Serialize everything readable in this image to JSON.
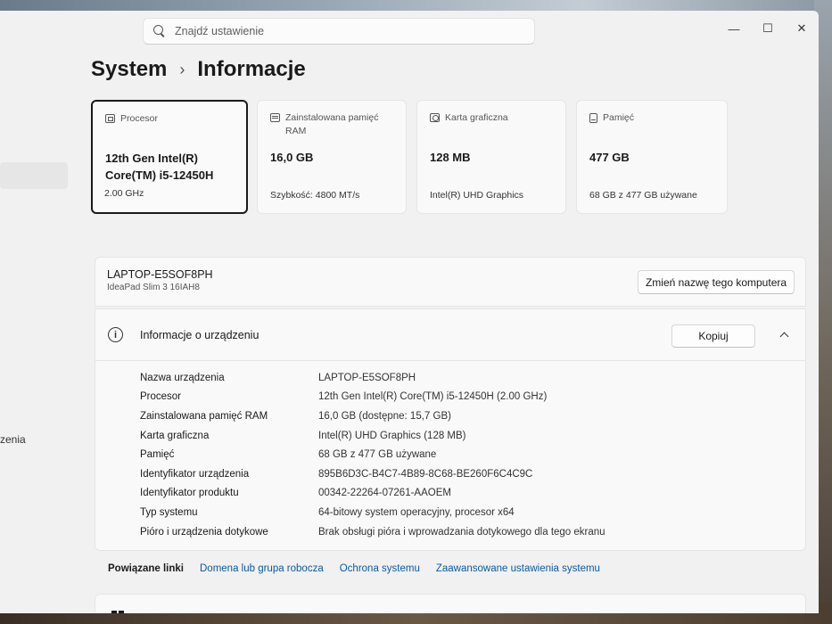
{
  "search": {
    "placeholder": "Znajdź ustawienie"
  },
  "window_controls": {
    "minimize": "—",
    "maximize": "☐",
    "close": "✕"
  },
  "breadcrumb": {
    "root": "System",
    "separator": "›",
    "current": "Informacje"
  },
  "sidebar": {
    "fragment_text": "zenia"
  },
  "cards": [
    {
      "icon": "processor-icon",
      "title": "Procesor",
      "value_line1": "12th Gen Intel(R)",
      "value_line2": "Core(TM) i5-12450H",
      "sub": "2.00 GHz"
    },
    {
      "icon": "memory-icon",
      "title": "Zainstalowana pamięć RAM",
      "value": "16,0 GB",
      "sub": "Szybkość: 4800 MT/s"
    },
    {
      "icon": "graphics-card-icon",
      "title": "Karta graficzna",
      "value": "128 MB",
      "sub": "Intel(R) UHD Graphics"
    },
    {
      "icon": "storage-icon",
      "title": "Pamięć",
      "value": "477 GB",
      "sub": "68 GB z 477 GB używane"
    }
  ],
  "device": {
    "name": "LAPTOP-E5SOF8PH",
    "model": "IdeaPad Slim 3 16IAH8",
    "rename_label": "Zmień nazwę tego komputera"
  },
  "device_info": {
    "title": "Informacje o urządzeniu",
    "copy_label": "Kopiuj",
    "rows": [
      {
        "label": "Nazwa urządzenia",
        "value": "LAPTOP-E5SOF8PH"
      },
      {
        "label": "Procesor",
        "value": "12th Gen Intel(R) Core(TM) i5-12450H (2.00 GHz)"
      },
      {
        "label": "Zainstalowana pamięć RAM",
        "value": "16,0 GB (dostępne: 15,7 GB)"
      },
      {
        "label": "Karta graficzna",
        "value": "Intel(R) UHD Graphics (128 MB)"
      },
      {
        "label": "Pamięć",
        "value": "68 GB z 477 GB używane"
      },
      {
        "label": "Identyfikator urządzenia",
        "value": "895B6D3C-B4C7-4B89-8C68-BE260F6C4C9C"
      },
      {
        "label": "Identyfikator produktu",
        "value": "00342-22264-07261-AAOEM"
      },
      {
        "label": "Typ systemu",
        "value": "64-bitowy system operacyjny, procesor x64"
      },
      {
        "label": "Pióro i urządzenia dotykowe",
        "value": "Brak obsługi pióra i wprowadzania dotykowego dla tego ekranu"
      }
    ]
  },
  "related_links": {
    "label": "Powiązane linki",
    "links": [
      "Domena lub grupa robocza",
      "Ochrona systemu",
      "Zaawansowane ustawienia systemu"
    ]
  }
}
